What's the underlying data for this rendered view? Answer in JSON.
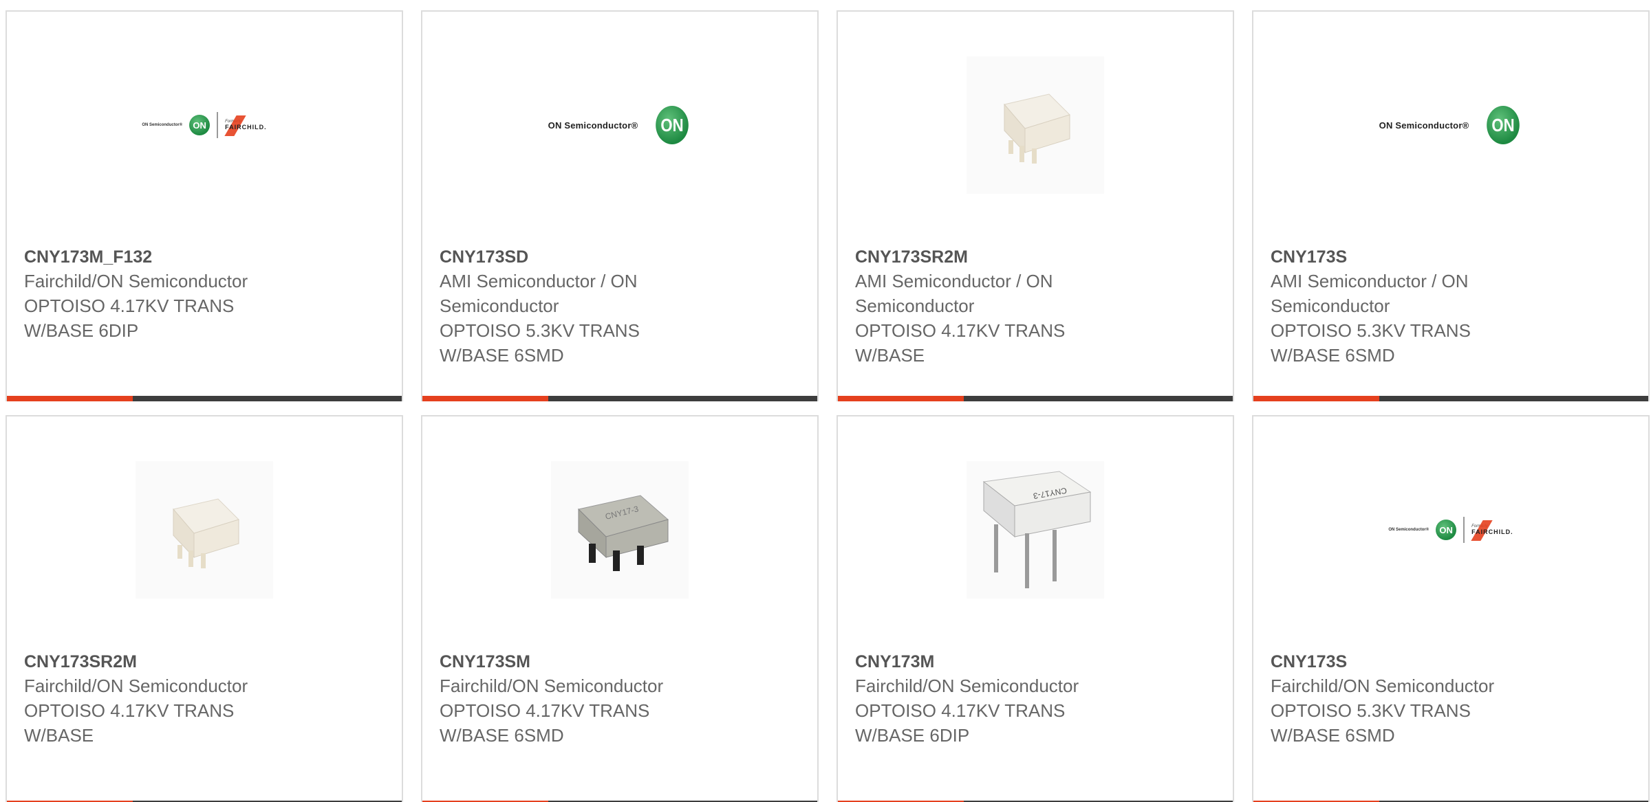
{
  "colors": {
    "accent": "#e5401e",
    "bar": "#3d3d3d",
    "border": "#dcdcdc",
    "on_green": "#1e8a42"
  },
  "cards": [
    {
      "part": "CNY173M_F132",
      "manufacturer": "Fairchild/ON Semiconductor",
      "desc1": "OPTOISO 4.17KV TRANS",
      "desc2": "W/BASE 6DIP",
      "image": "on-fairchild-logo"
    },
    {
      "part": "CNY173SD",
      "manufacturer": "AMI Semiconductor / ON",
      "manufacturer2": "Semiconductor",
      "desc1": "OPTOISO 5.3KV TRANS",
      "desc2": "W/BASE 6SMD",
      "image": "on-semiconductor-logo"
    },
    {
      "part": "CNY173SR2M",
      "manufacturer": "AMI Semiconductor / ON",
      "manufacturer2": "Semiconductor",
      "desc1": "OPTOISO 4.17KV TRANS",
      "desc2": "W/BASE",
      "image": "white-smd-chip"
    },
    {
      "part": "CNY173S",
      "manufacturer": "AMI Semiconductor / ON",
      "manufacturer2": "Semiconductor",
      "desc1": "OPTOISO 5.3KV TRANS",
      "desc2": "W/BASE 6SMD",
      "image": "on-semiconductor-logo"
    },
    {
      "part": "CNY173SR2M",
      "manufacturer": "Fairchild/ON Semiconductor",
      "desc1": "OPTOISO 4.17KV TRANS",
      "desc2": "W/BASE",
      "image": "white-smd-chip"
    },
    {
      "part": "CNY173SM",
      "manufacturer": "Fairchild/ON Semiconductor",
      "desc1": "OPTOISO 4.17KV TRANS",
      "desc2": "W/BASE 6SMD",
      "image": "gray-smd-chip"
    },
    {
      "part": "CNY173M",
      "manufacturer": "Fairchild/ON Semiconductor",
      "desc1": "OPTOISO 4.17KV TRANS",
      "desc2": "W/BASE 6DIP",
      "image": "white-dip-chip"
    },
    {
      "part": "CNY173S",
      "manufacturer": "Fairchild/ON Semiconductor",
      "desc1": "OPTOISO 5.3KV TRANS",
      "desc2": "W/BASE 6SMD",
      "image": "on-fairchild-logo"
    }
  ],
  "logos": {
    "on_text": "ON Semiconductor®",
    "on_badge": "ON",
    "formerly": "Formerly",
    "fairchild": "FAIRCHILD."
  },
  "chip_labels": {
    "gray": "CNY17-3",
    "dip": "CNY17-3"
  }
}
